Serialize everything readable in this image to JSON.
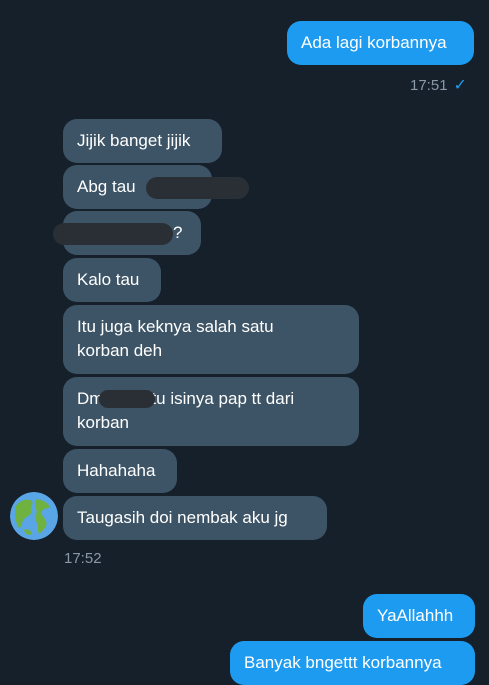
{
  "messages": {
    "out_1": "Ada lagi korbannya",
    "in_1": "Jijik banget jijik",
    "in_2": "Abg tau",
    "in_3_tail": "?",
    "in_4": "Kalo tau",
    "in_5_line1": "Itu juga keknya salah satu",
    "in_5_line2": "korban deh",
    "in_6_prefix": "Dm",
    "in_6_suffix": "tu isinya pap tt dari",
    "in_6_line2": "korban",
    "in_7": "Hahahaha",
    "in_8": "Taugasih doi nembak aku jg",
    "out_2": "YaAllahhh",
    "out_3": "Banyak bngettt korbannya"
  },
  "timestamps": {
    "sent": "17:51",
    "received": "17:52"
  },
  "icons": {
    "read_receipt": "checkmark-icon",
    "avatar": "globe-icon"
  },
  "colors": {
    "background": "#15202b",
    "incoming_bubble": "#3d5466",
    "outgoing_bubble": "#1d9bf0",
    "timestamp": "#8b98a5"
  }
}
